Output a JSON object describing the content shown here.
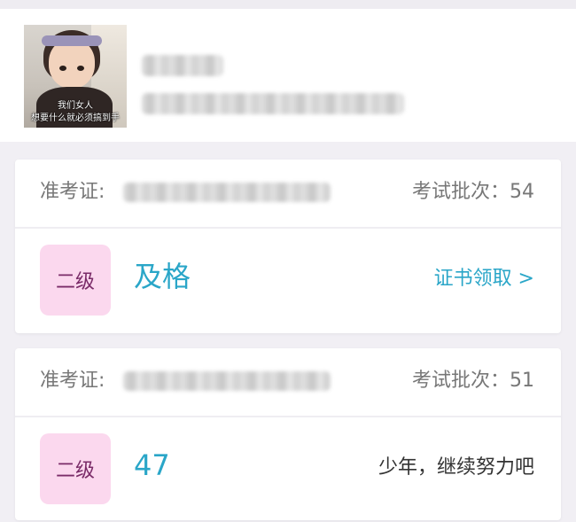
{
  "profile": {
    "avatar_caption_line1": "我们女人",
    "avatar_caption_line2": "想要什么就必须搞到手"
  },
  "records": [
    {
      "ticket_label": "准考证:",
      "batch_text": "考试批次：54",
      "level": "二级",
      "result": "及格",
      "action": "证书领取 >"
    },
    {
      "ticket_label": "准考证:",
      "batch_text": "考试批次：51",
      "level": "二级",
      "result": "47",
      "message": "少年，继续努力吧"
    }
  ],
  "colors": {
    "accent": "#2aa6c8",
    "badge_bg": "#fbd8ee",
    "badge_text": "#7a2b68",
    "page_bg": "#f1eff4"
  }
}
